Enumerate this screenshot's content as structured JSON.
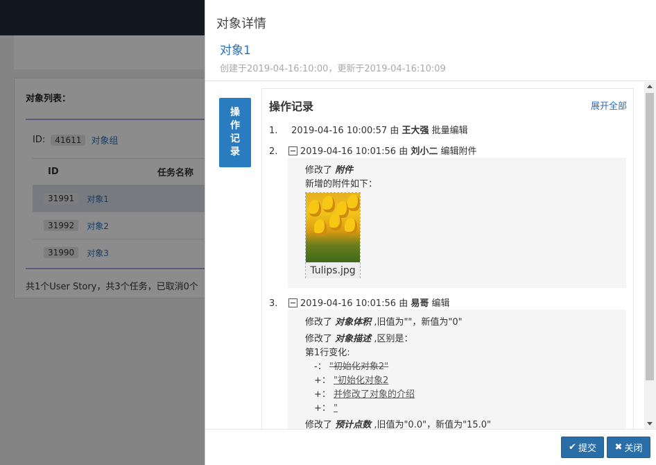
{
  "background": {
    "list_title": "对象列表：",
    "group_label": "ID:",
    "group_id": "41611",
    "group_name": "对象组",
    "columns": [
      "ID",
      "任务名称"
    ],
    "rows": [
      {
        "id": "31991",
        "name": "对象1"
      },
      {
        "id": "31992",
        "name": "对象2"
      },
      {
        "id": "31990",
        "name": "对象3"
      }
    ],
    "footer": "共1个User Story，共3个任务，已取消0个"
  },
  "modal": {
    "title": "对象详情",
    "object_name": "对象1",
    "meta": "创建于2019-04-16:10:00，更新于2019-04-16:10:09",
    "side_tab": "操作记录",
    "panel_title": "操作记录",
    "expand_all": "展开全部",
    "records": [
      {
        "num": "1.",
        "time": "2019-04-16 10:00:57",
        "by": "由",
        "user": "王大强",
        "action": "批量编辑"
      },
      {
        "num": "2.",
        "time": "2019-04-16 10:01:56",
        "by": "由",
        "user": "刘小二",
        "action": "编辑附件"
      },
      {
        "num": "3.",
        "time": "2019-04-16 10:01:56",
        "by": "由",
        "user": "易哥",
        "action": "编辑"
      }
    ],
    "rec2_detail": {
      "modified": "修改了",
      "field": "附件",
      "added_text": "新增的附件如下：",
      "attachment": "Tulips.jpg"
    },
    "rec3_detail": {
      "l1_pre": "修改了",
      "l1_field": "对象体积",
      "l1_post": ",旧值为\"\"，新值为\"0\"",
      "l2_pre": "修改了",
      "l2_field": "对象描述",
      "l2_post": ",区别是：",
      "l3": "第1行变化:",
      "l4_sign": "-：",
      "l4_text": "\"初始化对象2\"",
      "l5_sign": "+：",
      "l5_text": "\"初始化对象2",
      "l6_sign": "+：",
      "l6_text": "并修改了对象的介绍",
      "l7_sign": "+：",
      "l7_text": "\"",
      "l8_pre": "修改了",
      "l8_field": "预计点数",
      "l8_post": ",旧值为\"0.0\"，新值为\"15.0\""
    },
    "submit_label": "提交",
    "close_label": "关闭",
    "icons": {
      "submit": "check-icon",
      "close": "x-icon"
    }
  }
}
